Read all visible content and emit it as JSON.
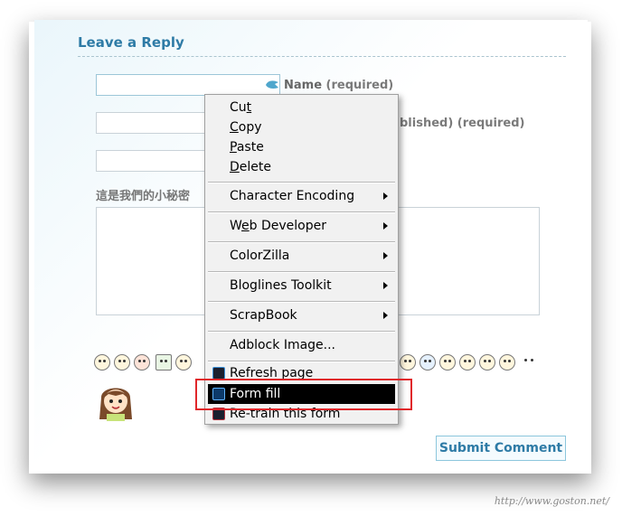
{
  "form": {
    "title": "Leave a Reply",
    "name_label_main": "Name",
    "name_label_suffix": "(required)",
    "email_label": "blished) (required)",
    "secret_label": "這是我們的小秘密",
    "submit_label": "Submit Comment"
  },
  "context_menu": {
    "items": [
      {
        "pre": "Cu",
        "key": "t",
        "post": ""
      },
      {
        "pre": "",
        "key": "C",
        "post": "opy"
      },
      {
        "pre": "",
        "key": "P",
        "post": "aste"
      },
      {
        "pre": "",
        "key": "D",
        "post": "elete"
      },
      {
        "label": "Character Encoding",
        "submenu": true
      },
      {
        "pre": "W",
        "key": "e",
        "post": "b Developer",
        "submenu": true
      },
      {
        "label": "ColorZilla",
        "submenu": true
      },
      {
        "label": "Bloglines Toolkit",
        "submenu": true
      },
      {
        "label": "ScrapBook",
        "submenu": true
      },
      {
        "label": "Adblock Image..."
      },
      {
        "label": "Refresh page",
        "icon": "refresh-page-icon"
      },
      {
        "label": "Form fill",
        "icon": "form-fill-icon",
        "selected": true
      },
      {
        "label": "Re-train this form",
        "icon": "retrain-form-icon"
      }
    ]
  },
  "colors": {
    "accent": "#2e7ba6",
    "highlight_box": "#e0262a",
    "menu_selected_bg": "#000000"
  },
  "emoticons": [
    "laughing-icon",
    "sad-icon",
    "red-hair-icon",
    "sprout-icon",
    "dizzy-icon",
    "sweat-icon",
    "crying-icon",
    "worried-icon",
    "angry-icon",
    "shocked-icon",
    "tired-icon",
    "sleepy-icon"
  ],
  "watermark": "http://www.goston.net/"
}
